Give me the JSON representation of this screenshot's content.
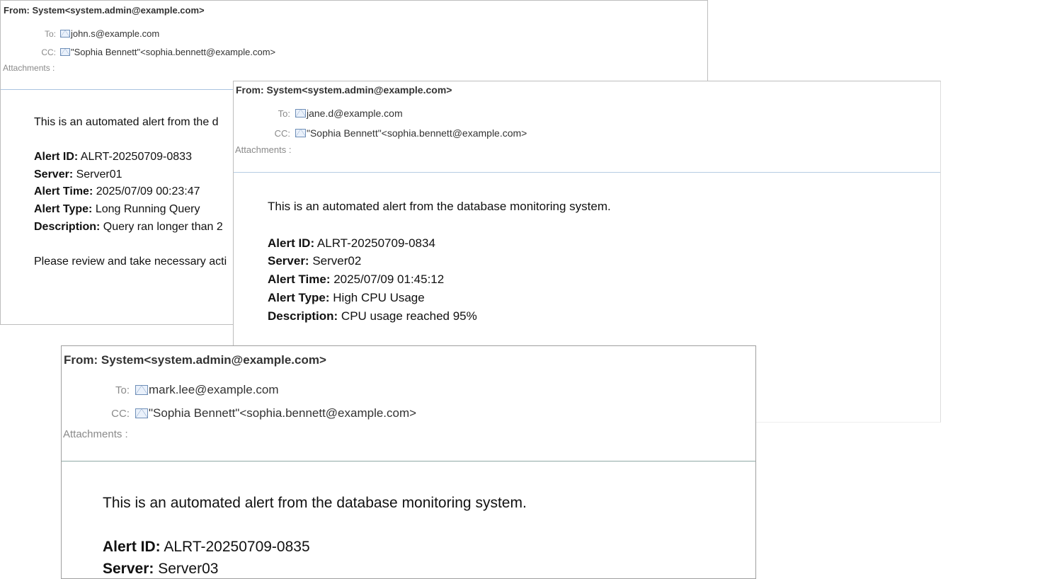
{
  "emails": [
    {
      "from": "From: System<system.admin@example.com>",
      "to_label": "To:",
      "to": "john.s@example.com",
      "cc_label": "CC:",
      "cc": "\"Sophia Bennett\"<sophia.bennett@example.com>",
      "attachments_label": "Attachments :",
      "intro": "This is an automated alert from the d",
      "fields": [
        {
          "label": "Alert ID:",
          "value": " ALRT-20250709-0833"
        },
        {
          "label": "Server:",
          "value": " Server01"
        },
        {
          "label": "Alert Time:",
          "value": " 2025/07/09 00:23:47"
        },
        {
          "label": "Alert Type:",
          "value": " Long Running Query"
        },
        {
          "label": "Description:",
          "value": " Query ran longer than 2"
        }
      ],
      "closing": "Please review and take necessary acti"
    },
    {
      "from": "From: System<system.admin@example.com>",
      "to_label": "To:",
      "to": "jane.d@example.com",
      "cc_label": "CC:",
      "cc": "\"Sophia Bennett\"<sophia.bennett@example.com>",
      "attachments_label": "Attachments :",
      "intro": "This is an automated alert from the database monitoring system.",
      "fields": [
        {
          "label": "Alert ID:",
          "value": " ALRT-20250709-0834"
        },
        {
          "label": "Server:",
          "value": " Server02"
        },
        {
          "label": "Alert Time:",
          "value": " 2025/07/09 01:45:12"
        },
        {
          "label": "Alert Type:",
          "value": " High CPU Usage"
        },
        {
          "label": "Description:",
          "value": " CPU usage reached 95%"
        }
      ]
    },
    {
      "from": "From: System<system.admin@example.com>",
      "to_label": "To:",
      "to": "mark.lee@example.com",
      "cc_label": "CC:",
      "cc": "\"Sophia Bennett\"<sophia.bennett@example.com>",
      "attachments_label": "Attachments :",
      "intro": "This is an automated alert from the database monitoring system.",
      "fields": [
        {
          "label": "Alert ID:",
          "value": " ALRT-20250709-0835"
        },
        {
          "label": "Server:",
          "value": " Server03"
        }
      ]
    }
  ]
}
